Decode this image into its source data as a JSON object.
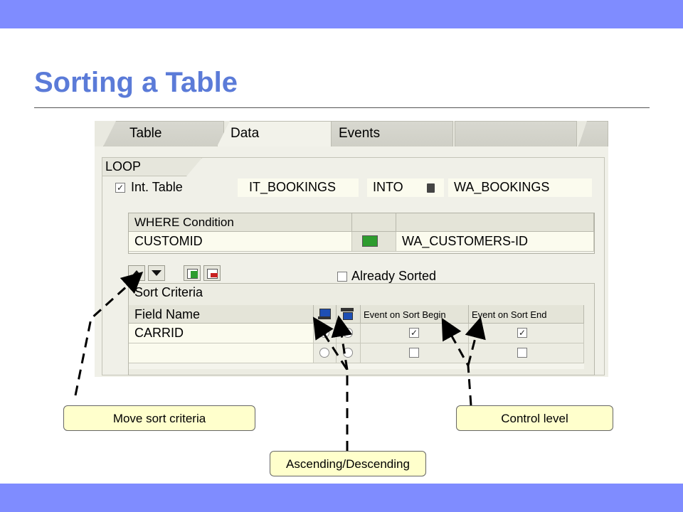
{
  "slide": {
    "title": "Sorting a Table"
  },
  "tabs": [
    {
      "label": "Table"
    },
    {
      "label": "Data"
    },
    {
      "label": "Events"
    }
  ],
  "loop": {
    "label": "LOOP",
    "int_table_label": "Int. Table",
    "int_table_checked": true,
    "table_name": "IT_BOOKINGS",
    "into_label": "INTO",
    "work_area": "WA_BOOKINGS"
  },
  "where": {
    "header": "WHERE Condition",
    "field": "CUSTOMID",
    "value": "WA_CUSTOMERS-ID"
  },
  "already_sorted": {
    "label": "Already Sorted",
    "checked": false
  },
  "sort": {
    "title": "Sort Criteria",
    "col_field": "Field Name",
    "col_begin": "Event on Sort Begin",
    "col_end": "Event on Sort End",
    "rows": [
      {
        "field": "CARRID",
        "ascending": true,
        "descending": false,
        "begin": true,
        "end": true
      },
      {
        "field": "",
        "ascending": false,
        "descending": false,
        "begin": false,
        "end": false
      }
    ]
  },
  "callouts": {
    "move": "Move sort criteria",
    "control": "Control level",
    "asc_desc": "Ascending/Descending"
  },
  "colors": {
    "band": "#7f8cff",
    "title": "#5b7bd8",
    "callout_bg": "#ffffcc"
  }
}
